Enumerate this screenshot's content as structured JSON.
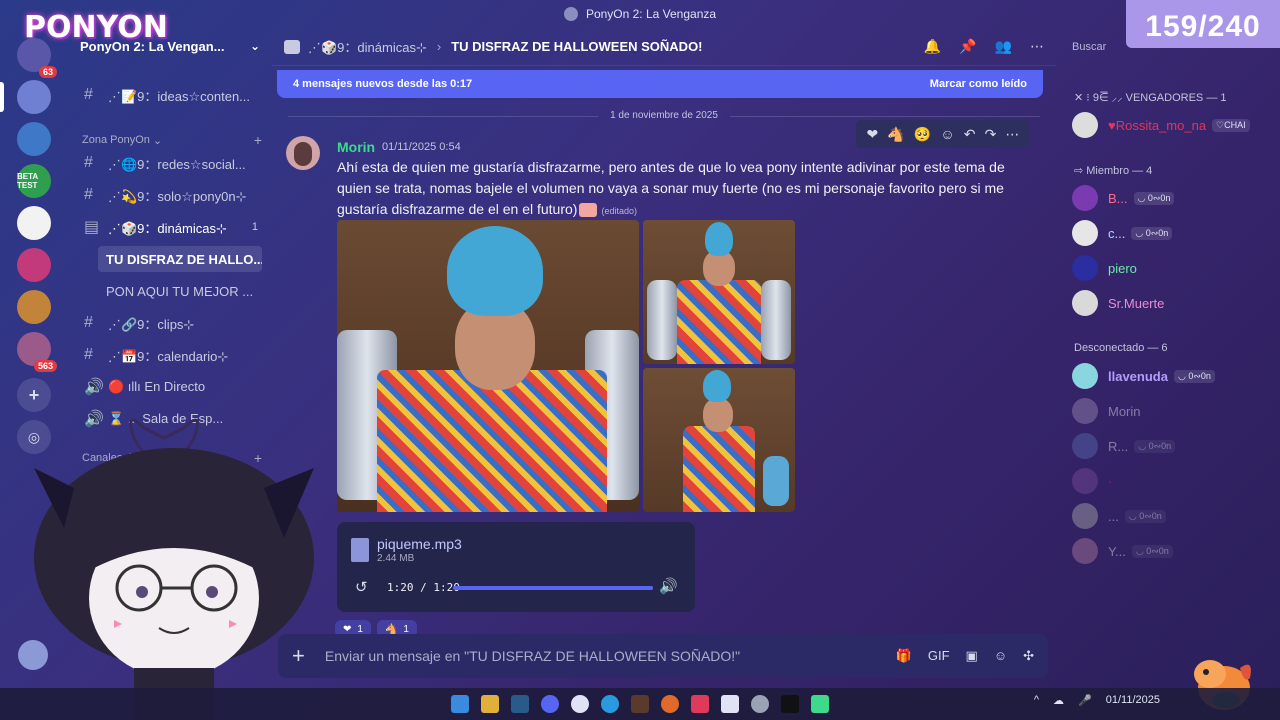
{
  "window": {
    "title": "PonyOn 2: La Venganza"
  },
  "overlay": {
    "logo_text": "PONYON",
    "viewer_count": "159/240"
  },
  "server": {
    "name": "PonyOn 2: La Vengan..."
  },
  "rail": {
    "badges": [
      "63",
      "563"
    ],
    "beta_label": "BETA TEST"
  },
  "channels": {
    "items": [
      {
        "label": "⋰📝9：ideas☆conten..."
      },
      {
        "label": "⋰🌐9：redes☆social..."
      },
      {
        "label": "⋰💫9：solo☆pony0n⊹"
      },
      {
        "label": "⋰🎲9：dinámicas⊹",
        "count": "1"
      },
      {
        "label": "TU DISFRAZ DE HALLO..."
      },
      {
        "label": "PON AQUI TU MEJOR ..."
      },
      {
        "label": "⋰🔗9：clips⊹"
      },
      {
        "label": "⋰📅9：calendario⊹"
      },
      {
        "label": "🔴 ıllı  En Directo"
      },
      {
        "label": "⌛ ... Sala de Esp..."
      }
    ],
    "categories": [
      "Zona PonyOn",
      "Canales de texto"
    ]
  },
  "header": {
    "crumb": "⋰🎲9：dinámicas⊹",
    "title": "TU DISFRAZ DE HALLOWEEN SOÑADO!",
    "search_placeholder": "Buscar"
  },
  "banner": {
    "text": "4 mensajes nuevos desde las 0:17",
    "action": "Marcar como leído"
  },
  "date_divider": "1 de noviembre de 2025",
  "message": {
    "author": "Morin",
    "time": "01/11/2025 0:54",
    "text": "Ahí esta de quien me gustaría disfrazarme, pero antes de que lo vea pony intente adivinar por este tema de quien se trata, nomas bajele el volumen no vaya a sonar muy fuerte (no es mi personaje favorito pero si me gustaría disfrazarme de el en el futuro)",
    "edited": "(editado)"
  },
  "audio": {
    "filename": "piqueme.mp3",
    "size": "2.44 MB",
    "time": "1:20 / 1:20",
    "progress": 1.0
  },
  "reactions": [
    {
      "emoji": "❤",
      "count": "1"
    },
    {
      "emoji": "🐴",
      "count": "1"
    }
  ],
  "composer": {
    "placeholder": "Enviar un mensaje en \"TU DISFRAZ DE HALLOWEEN SOÑADO!\""
  },
  "members": {
    "groups": [
      {
        "label": "✕ ⁝ 9⋶ ⸝⸝ VENGADORES — 1"
      },
      {
        "label": "⇨ Miembro — 4"
      },
      {
        "label": "Desconectado — 6"
      }
    ],
    "online": [
      {
        "name": "♥Rossita_mo_na",
        "tag": "♡CHAI",
        "color": "#e0365a"
      },
      {
        "name": "B...",
        "tag": "◡ 0∾0n",
        "color": "#ff6b8a"
      },
      {
        "name": "c...",
        "tag": "◡ 0∾0n",
        "color": "#9ce0ff"
      },
      {
        "name": "piero",
        "tag": "",
        "color": "#6de8a8"
      },
      {
        "name": "Sr.Muerte",
        "tag": "",
        "color": "#e98cd6"
      }
    ],
    "offline": [
      {
        "name": "llavenuda",
        "tag": "◡ 0∾0n",
        "color": "#b49cff"
      },
      {
        "name": "Morin",
        "tag": "",
        "color": "#c2c5db"
      },
      {
        "name": "R...",
        "tag": "◡ 0∾0n",
        "color": "#c2c5db"
      },
      {
        "name": "·",
        "tag": "",
        "color": "#e0365a"
      },
      {
        "name": "...",
        "tag": "◡ 0∾0n",
        "color": "#c2c5db"
      },
      {
        "name": "Y...",
        "tag": "◡ 0∾0n",
        "color": "#c2c5db"
      }
    ]
  },
  "tray": {
    "date": "01/11/2025"
  },
  "colors": {
    "accent": "#5865f2",
    "author": "#3ed98a"
  }
}
